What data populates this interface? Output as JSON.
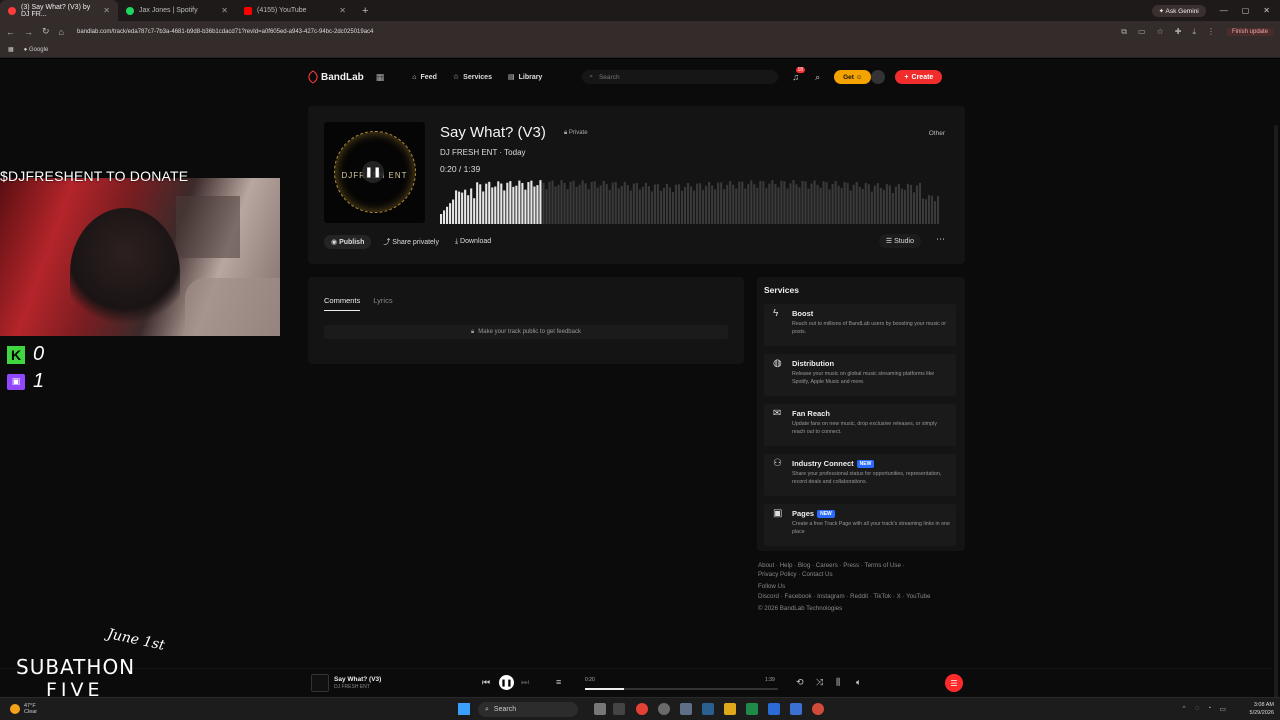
{
  "browser": {
    "tabs": [
      {
        "label": "(3) Say What? (V3) by DJ FR...",
        "color": "#ff3b3b",
        "active": true
      },
      {
        "label": "Jax Jones | Spotify",
        "color": "#1ed760",
        "active": false
      },
      {
        "label": "(4155) YouTube",
        "color": "#ff0000",
        "active": false
      }
    ],
    "ask_gemini": "Ask Gemini",
    "url": "bandlab.com/track/eda787c7-7b3a-4681-b9d8-b36b1cdacd71?revId=a0f605ed-a943-427c-94bc-2dc025019ac4",
    "finish_update": "Finish update",
    "bookmark": "Google"
  },
  "bandlab": {
    "logo": "BandLab",
    "nav": {
      "feed": "Feed",
      "services": "Services",
      "library": "Library"
    },
    "search_placeholder": "Search",
    "notification_count": "18",
    "get_label": "Get",
    "create_label": "Create"
  },
  "track": {
    "title": "Say What? (V3)",
    "privacy": "Private",
    "genre": "Other",
    "artist": "DJ FRESH ENT",
    "when": "Today",
    "time_display": "0:20 / 1:39",
    "cover_text": "DJFRESH ENT",
    "progress_fraction": 0.2,
    "actions": {
      "publish": "Publish",
      "share": "Share privately",
      "download": "Download",
      "studio": "Studio"
    }
  },
  "comments": {
    "tabs": [
      "Comments",
      "Lyrics"
    ],
    "notice": "Make your track public to get feedback"
  },
  "services": {
    "heading": "Services",
    "items": [
      {
        "title": "Boost",
        "new": false,
        "desc": "Reach out to millions of BandLab users by boosting your music or posts.",
        "icon": "lightning-icon"
      },
      {
        "title": "Distribution",
        "new": false,
        "desc": "Release your music on global music streaming platforms like Spotify, Apple Music and more.",
        "icon": "globe-icon"
      },
      {
        "title": "Fan Reach",
        "new": false,
        "desc": "Update fans on new music, drop exclusive releases, or simply reach out to connect.",
        "icon": "mail-icon"
      },
      {
        "title": "Industry Connect",
        "new": true,
        "desc": "Share your professional status for opportunities, representation, record deals and collaborations.",
        "icon": "people-icon"
      },
      {
        "title": "Pages",
        "new": true,
        "desc": "Create a free Track Page with all your track's streaming links in one place",
        "icon": "pages-icon"
      }
    ],
    "new_label": "NEW"
  },
  "footer": {
    "line1": "About · Help · Blog · Careers · Press · Terms of Use ·",
    "line2": "Privacy Policy · Contact Us",
    "follow": "Follow Us",
    "socials": "Discord · Facebook · Instagram · Reddit · TikTok · X · YouTube",
    "copyright": "© 2026 BandLab Technologies"
  },
  "player": {
    "title": "Say What? (V3)",
    "artist": "DJ FRESH ENT",
    "start": "0:20",
    "end": "1:39",
    "progress_fraction": 0.2
  },
  "overlay": {
    "donate": "$DJFRESHENT TO DONATE",
    "kick_count": "0",
    "twitch_count": "1",
    "kick_letter": "K",
    "subathon": "SUBATHON",
    "date": "June 1st",
    "five": "FIVE"
  },
  "taskbar": {
    "temp": "47°F",
    "cond": "Clear",
    "search": "Search",
    "time": "3:08 AM",
    "date": "5/29/2026"
  }
}
